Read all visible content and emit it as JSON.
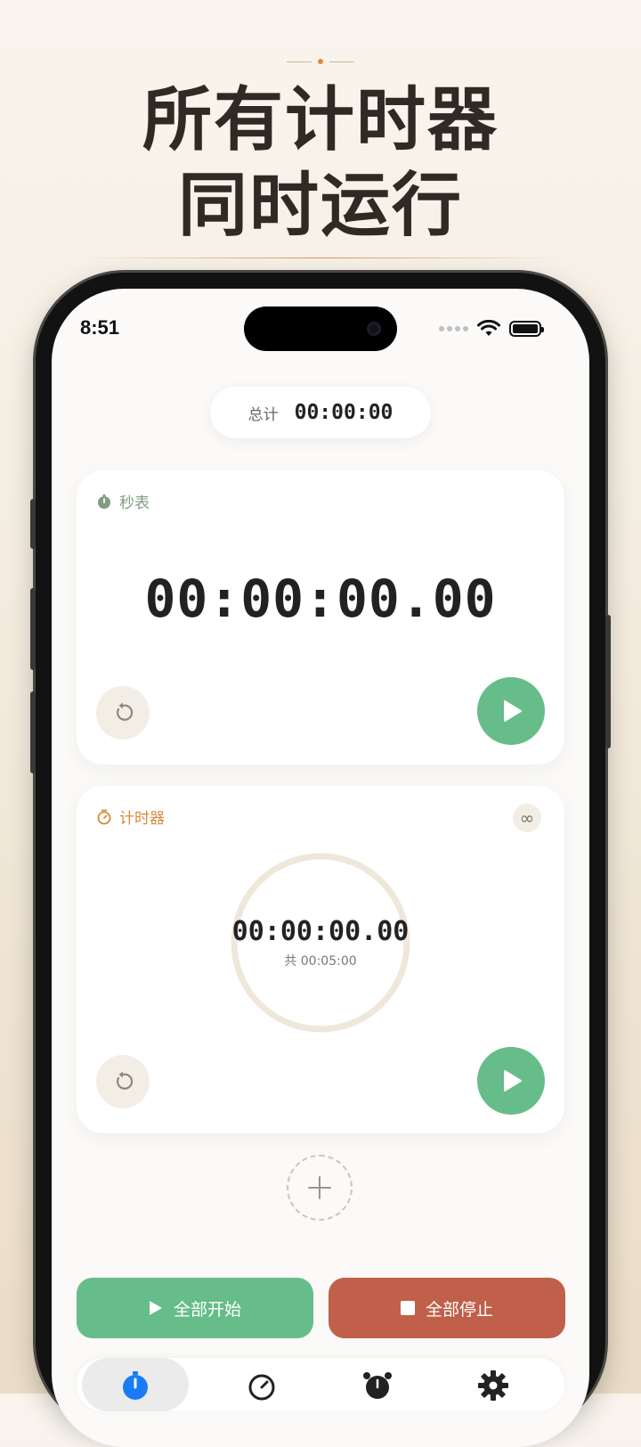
{
  "headline": {
    "line1": "所有计时器",
    "line2": "同时运行"
  },
  "status_bar": {
    "time": "8:51"
  },
  "total": {
    "label": "总计",
    "value": "00:00:00"
  },
  "stopwatch_card": {
    "label": "秒表",
    "time": "00:00:00.00"
  },
  "timer_card": {
    "label": "计时器",
    "time": "00:00:00.00",
    "total": "共 00:05:00",
    "loop_symbol": "∞",
    "progress": 0
  },
  "actions": {
    "start_all": "全部开始",
    "stop_all": "全部停止"
  },
  "tabs": [
    "stopwatch-icon",
    "timer-icon",
    "alarm-icon",
    "settings-icon"
  ],
  "colors": {
    "green": "#66bd8a",
    "red": "#c0604a",
    "orange": "#d9893a",
    "accent_blue": "#1a7cf5"
  }
}
